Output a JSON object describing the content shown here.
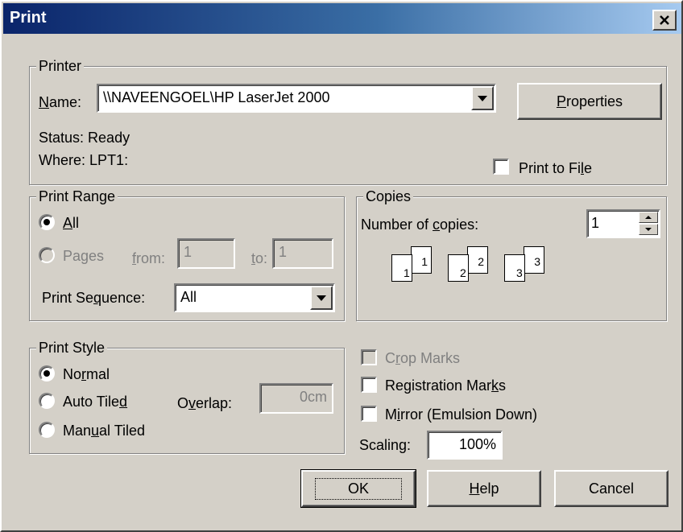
{
  "window": {
    "title": "Print"
  },
  "printer": {
    "group_label": "Printer",
    "name_label": "Name:",
    "name_value": "\\\\NAVEENGOEL\\HP LaserJet 2000",
    "properties_button": "Properties",
    "status_label": "Status:",
    "status_value": "Ready",
    "where_label": "Where:",
    "where_value": "LPT1:",
    "print_to_file_label": "Print to File",
    "print_to_file_checked": false
  },
  "print_range": {
    "group_label": "Print Range",
    "all_label": "All",
    "pages_label": "Pages",
    "from_label": "from:",
    "from_value": "1",
    "to_label": "to:",
    "to_value": "1",
    "selected": "All",
    "sequence_label": "Print Sequence:",
    "sequence_value": "All"
  },
  "copies": {
    "group_label": "Copies",
    "number_label": "Number of copies:",
    "number_value": "1",
    "collate_pages": [
      "1",
      "1",
      "2",
      "2",
      "3",
      "3"
    ]
  },
  "print_style": {
    "group_label": "Print Style",
    "normal_label": "Normal",
    "auto_tiled_label": "Auto Tiled",
    "manual_tiled_label": "Manual Tiled",
    "overlap_label": "Overlap:",
    "overlap_value": "0cm",
    "selected": "Normal"
  },
  "options": {
    "crop_marks_label": "Crop Marks",
    "registration_marks_label": "Registration Marks",
    "mirror_label": "Mirror (Emulsion Down)",
    "scaling_label": "Scaling:",
    "scaling_value": "100%"
  },
  "buttons": {
    "ok": "OK",
    "help": "Help",
    "cancel": "Cancel"
  },
  "colors": {
    "dialog_face": "#d4d0c8",
    "title_gradient_start": "#0a246a",
    "title_gradient_end": "#a6caf0",
    "disabled_text": "#808080"
  }
}
